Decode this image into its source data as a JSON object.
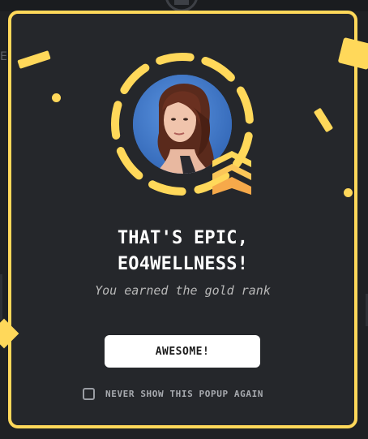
{
  "popup": {
    "title_line1": "THAT'S EPIC,",
    "title_line2": "EO4WELLNESS!",
    "subtitle": "You earned the gold rank",
    "button_label": "AWESOME!",
    "checkbox_label": "NEVER SHOW THIS POPUP AGAIN",
    "checkbox_checked": false,
    "rank": "gold",
    "icons": {
      "avatar": "user-avatar",
      "badge": "gold-rank-chevrons-icon",
      "checkbox": "checkbox-icon"
    }
  },
  "background": {
    "left_letter": "E"
  },
  "colors": {
    "accent": "#ffd85a",
    "modal_bg": "#25272b",
    "page_bg": "#1f2124",
    "button_bg": "#ffffff",
    "badge_orange": "#f6a94a"
  }
}
